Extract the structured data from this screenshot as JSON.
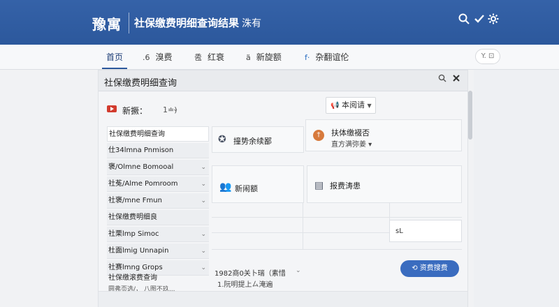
{
  "header": {
    "logo": "豫寓",
    "title": "社保缴费明细查询结果",
    "subtitle": "洙有",
    "icons": [
      "search-icon",
      "check-icon",
      "gear-icon"
    ]
  },
  "nav": {
    "tabs": [
      {
        "icon": "",
        "label": "首页"
      },
      {
        "icon": ".6",
        "label": "溴费"
      },
      {
        "icon": "卺",
        "label": "红衰"
      },
      {
        "icon": "ä",
        "label": "新旋额"
      },
      {
        "icon": "f·",
        "label": "杂翻谊伦"
      }
    ],
    "right_button": "Y. ⊡"
  },
  "panel": {
    "title": "社保缴费明细查询",
    "filter_label": "新撅：",
    "filter_value": "1≐)",
    "dropdown_label": "本阅请",
    "list_items": [
      "社保缴费明细查询",
      "仕34lmna Pnmison",
      "褒/Olmne Bomooal",
      "社菟/Alme Pomroom",
      "社褒/mne Fmun",
      "社保缴费明细良",
      "社栗lmp Simoc",
      "杜面lmig Unnapin",
      "社赛lmng Grops"
    ],
    "list_footer_title": "社保缴滚费查询",
    "list_footer_sub": "圆弗页选/，  八图不玖...",
    "cards": [
      {
        "label": "撞势余续鄙"
      },
      {
        "label": "扶体缴裰否",
        "sub": "直方满弥姜 ▾"
      },
      {
        "label": "新闹额"
      },
      {
        "label": "报费涛患"
      }
    ],
    "note": "sL",
    "bottom_line1": "1982商0关卜瑞（素惜",
    "bottom_line2": "1.阮明提上ㄙ淹遍",
    "action_button": "资费搜费"
  }
}
